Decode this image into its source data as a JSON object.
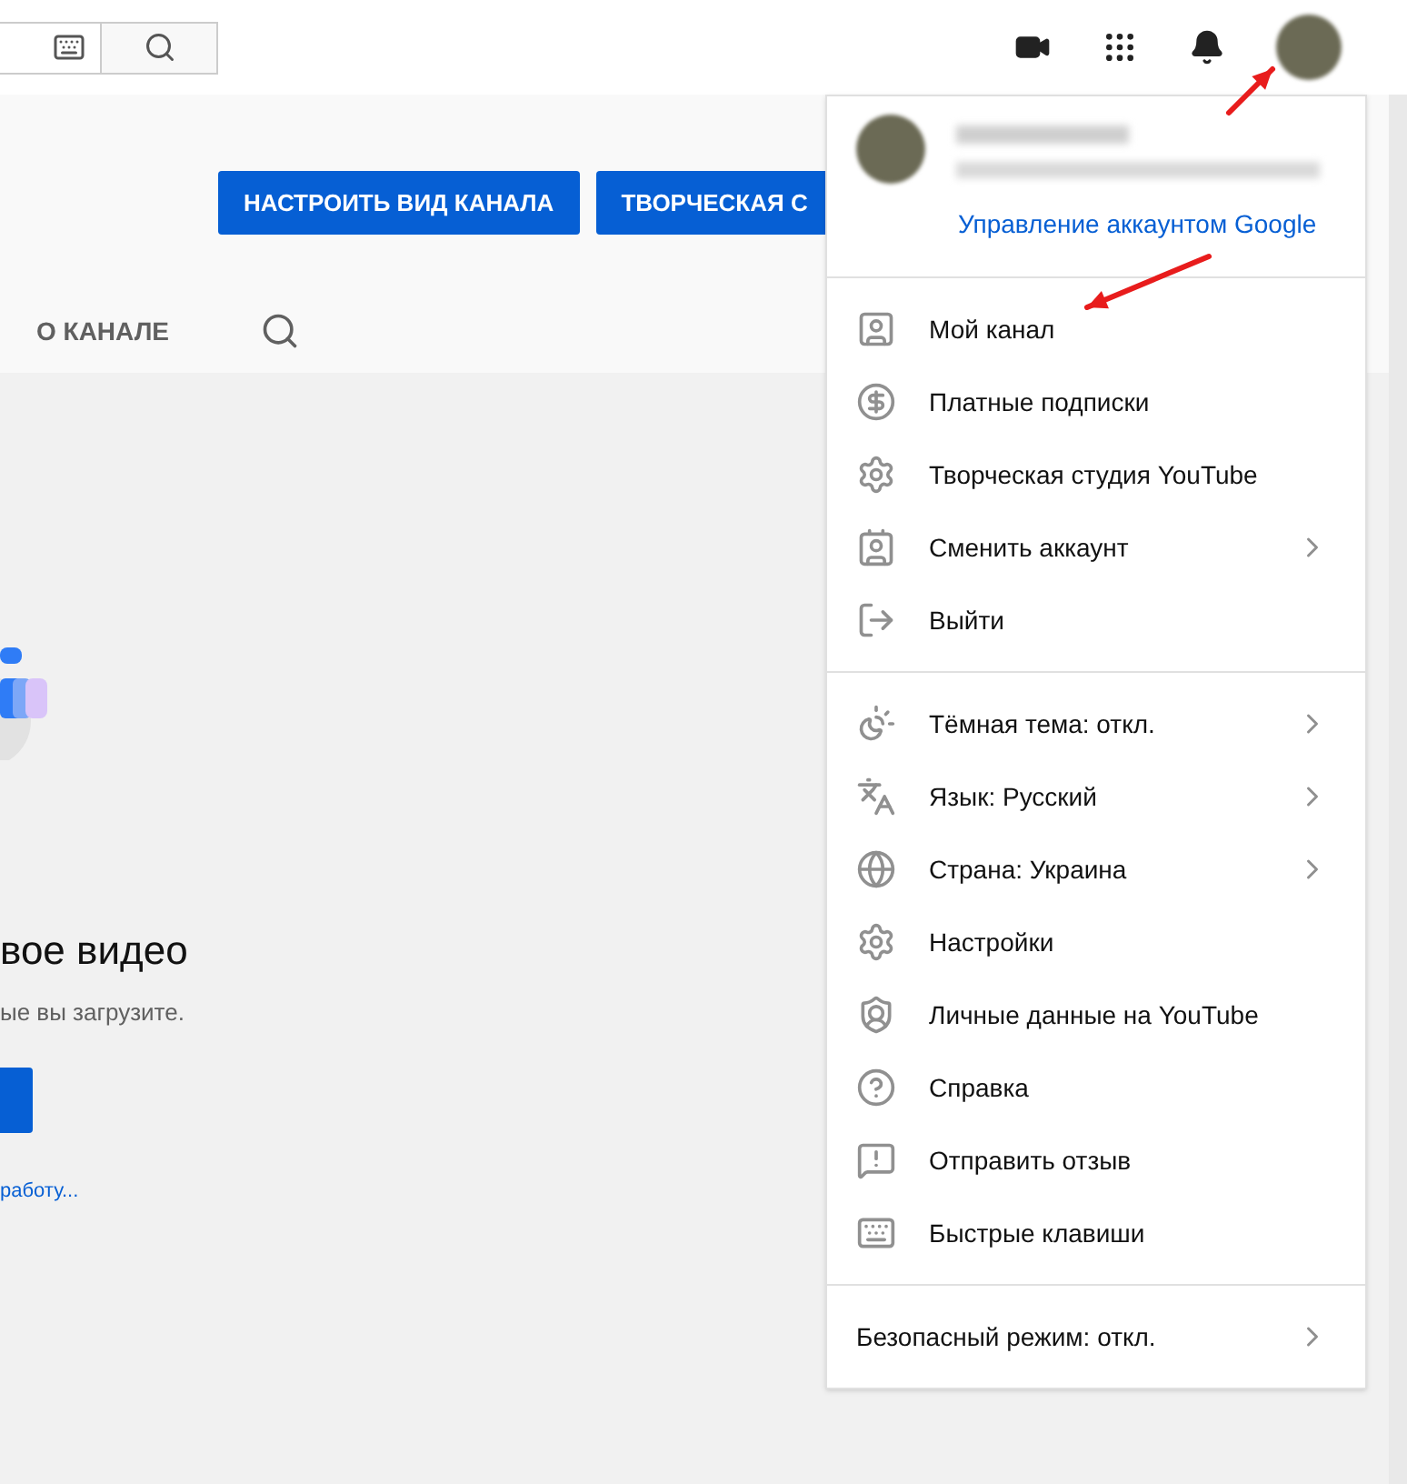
{
  "channel_buttons": [
    {
      "label": "НАСТРОИТЬ ВИД КАНАЛА"
    },
    {
      "label": "ТВОРЧЕСКАЯ С"
    }
  ],
  "tabs": [
    {
      "label": "О КАНАЛЕ",
      "selected": false
    }
  ],
  "empty_state": {
    "title": "вое видео",
    "subtitle": "ые вы загрузите.",
    "link": "работу..."
  },
  "account_menu": {
    "manage_link": "Управление аккаунтом Google",
    "sections": [
      [
        {
          "label": "Мой канал",
          "submenu": false
        },
        {
          "label": "Платные подписки",
          "submenu": false
        },
        {
          "label": "Творческая студия YouTube",
          "submenu": false
        },
        {
          "label": "Сменить аккаунт",
          "submenu": true
        },
        {
          "label": "Выйти",
          "submenu": false
        }
      ],
      [
        {
          "label": "Тёмная тема: откл.",
          "submenu": true
        },
        {
          "label": "Язык: Русский",
          "submenu": true
        },
        {
          "label": "Страна: Украина",
          "submenu": true
        },
        {
          "label": "Настройки",
          "submenu": false
        },
        {
          "label": "Личные данные на YouTube",
          "submenu": false
        },
        {
          "label": "Справка",
          "submenu": false
        },
        {
          "label": "Отправить отзыв",
          "submenu": false
        },
        {
          "label": "Быстрые клавиши",
          "submenu": false
        }
      ],
      [
        {
          "label": "Безопасный режим: откл.",
          "submenu": true
        }
      ]
    ]
  }
}
